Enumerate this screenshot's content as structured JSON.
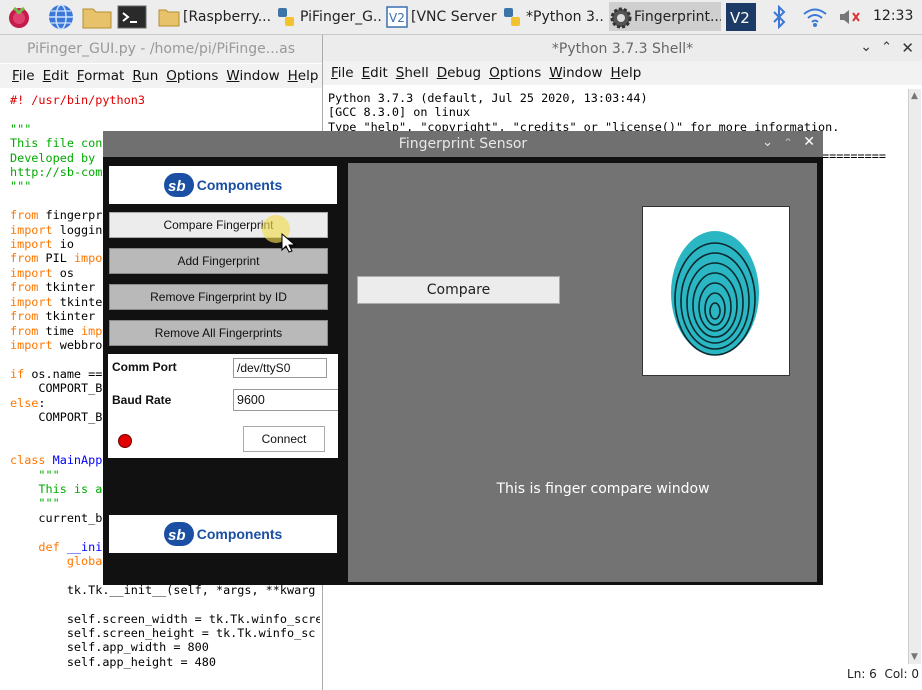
{
  "taskbar": {
    "items": [
      {
        "label": "[Raspberry..."
      },
      {
        "label": "PiFinger_G..."
      },
      {
        "label": "[VNC Server]"
      },
      {
        "label": "*Python 3...."
      },
      {
        "label": "Fingerprint..."
      }
    ],
    "clock": "12:33"
  },
  "editor": {
    "title": "PiFinger_GUI.py - /home/pi/PiFinge...as",
    "menu": [
      "File",
      "Edit",
      "Format",
      "Run",
      "Options",
      "Window",
      "Help"
    ]
  },
  "shell": {
    "title": "*Python 3.7.3 Shell*",
    "menu": [
      "File",
      "Edit",
      "Shell",
      "Debug",
      "Options",
      "Window",
      "Help"
    ],
    "lines": [
      "Python 3.7.3 (default, Jul 25 2020, 13:03:44)",
      "[GCC 8.3.0] on linux",
      "Type \"help\", \"copyright\", \"credits\" or \"license()\" for more information."
    ],
    "rule": "=========",
    "status": "Ln: 6  Col: 0"
  },
  "fp": {
    "title": "Fingerprint Sensor",
    "logo_text": "Components",
    "buttons": [
      "Compare Fingerprint",
      "Add Fingerprint",
      "Remove Fingerprint by ID",
      "Remove All Fingerprints"
    ],
    "comm_label": "Comm Port",
    "comm_value": "/dev/ttyS0",
    "baud_label": "Baud Rate",
    "baud_value": "9600",
    "connect_label": "Connect",
    "compare_label": "Compare",
    "message": "This is finger compare window"
  },
  "colors": {
    "accent": "#1a4fa3",
    "fingerprint": "#2bb6c4",
    "status_dot": "#e00000"
  }
}
